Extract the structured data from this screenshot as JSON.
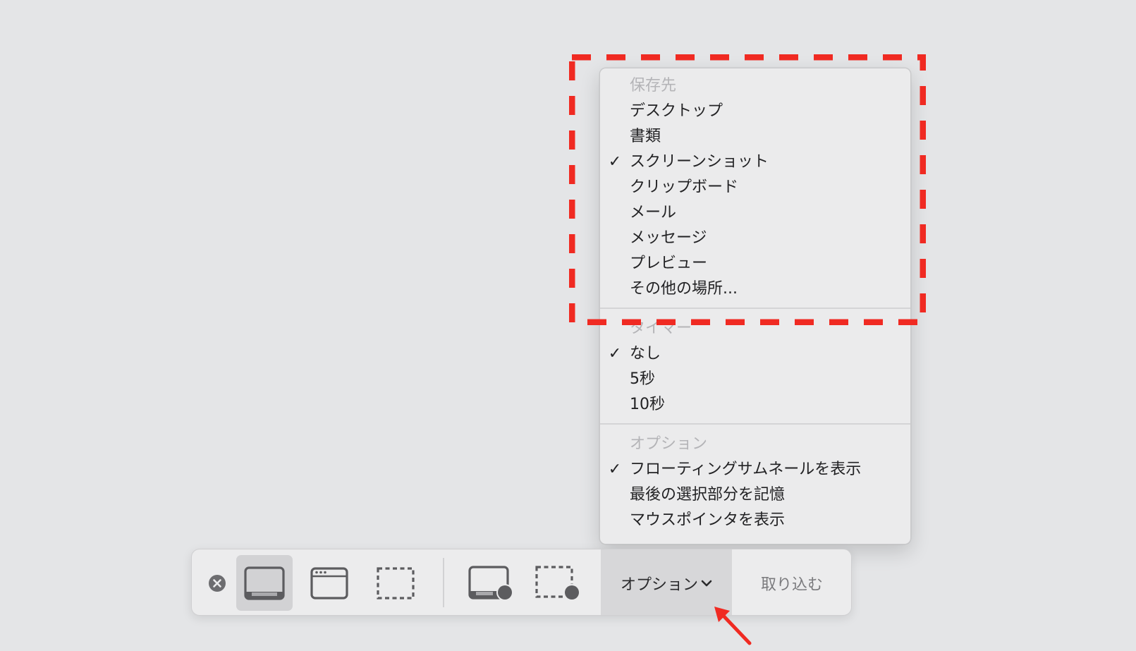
{
  "menu": {
    "save_to": {
      "header": "保存先",
      "items": [
        {
          "label": "デスクトップ",
          "checked": false
        },
        {
          "label": "書類",
          "checked": false
        },
        {
          "label": "スクリーンショット",
          "checked": true
        },
        {
          "label": "クリップボード",
          "checked": false
        },
        {
          "label": "メール",
          "checked": false
        },
        {
          "label": "メッセージ",
          "checked": false
        },
        {
          "label": "プレビュー",
          "checked": false
        },
        {
          "label": "その他の場所...",
          "checked": false
        }
      ]
    },
    "timer": {
      "header": "タイマー",
      "items": [
        {
          "label": "なし",
          "checked": true
        },
        {
          "label": "5秒",
          "checked": false
        },
        {
          "label": "10秒",
          "checked": false
        }
      ]
    },
    "options": {
      "header": "オプション",
      "items": [
        {
          "label": "フローティングサムネールを表示",
          "checked": true
        },
        {
          "label": "最後の選択部分を記憶",
          "checked": false
        },
        {
          "label": "マウスポインタを表示",
          "checked": false
        }
      ]
    },
    "check_glyph": "✓"
  },
  "toolbar": {
    "options_label": "オプション",
    "capture_label": "取り込む",
    "selected_mode": "capture-entire-screen"
  },
  "annotations": {
    "highlight_color": "#f02a22",
    "arrow_color": "#f02a22"
  },
  "icons": {
    "close": "close-icon",
    "capture_entire_screen": "capture-entire-screen-icon",
    "capture_window": "capture-window-icon",
    "capture_selection": "capture-selection-icon",
    "record_entire_screen": "record-entire-screen-icon",
    "record_selection": "record-selection-icon",
    "chevron": "chevron-down-icon"
  }
}
